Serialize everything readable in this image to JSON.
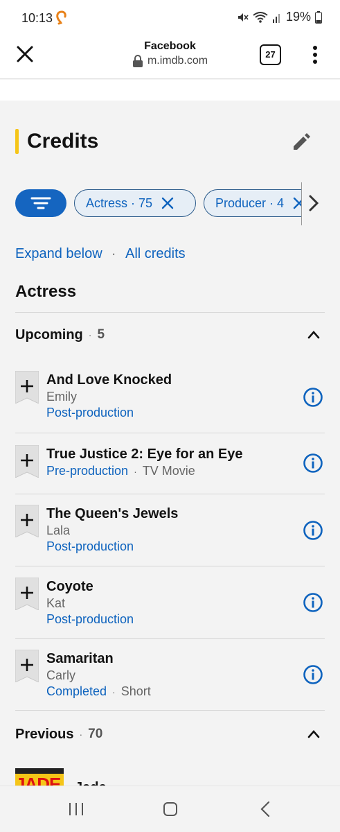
{
  "status_bar": {
    "time": "10:13",
    "battery": "19%",
    "icons": [
      "notification-icon",
      "mute-icon",
      "wifi-icon",
      "signal-icon",
      "battery-icon"
    ]
  },
  "browser": {
    "title": "Facebook",
    "url": "m.imdb.com",
    "tab_count": "27"
  },
  "page": {
    "heading": "Credits",
    "filters": {
      "chips": [
        {
          "label": "Actress · 75"
        },
        {
          "label": "Producer · 4"
        }
      ]
    },
    "links": {
      "expand": "Expand below",
      "separator": "·",
      "all": "All credits"
    },
    "section_title": "Actress",
    "upcoming": {
      "title": "Upcoming",
      "count": "5",
      "items": [
        {
          "title": "And Love Knocked",
          "role": "Emily",
          "status": "Post-production"
        },
        {
          "title": "True Justice 2: Eye for an Eye",
          "status": "Pre-production",
          "type": "TV Movie"
        },
        {
          "title": "The Queen's Jewels",
          "role": "Lala",
          "status": "Post-production"
        },
        {
          "title": "Coyote",
          "role": "Kat",
          "status": "Post-production"
        },
        {
          "title": "Samaritan",
          "role": "Carly",
          "status": "Completed",
          "type": "Short"
        }
      ]
    },
    "previous": {
      "title": "Previous",
      "count": "70",
      "peek_item_title": "Jade",
      "poster_text": "JADE"
    }
  },
  "colors": {
    "accent_yellow": "#f5c518",
    "link_blue": "#0e63be",
    "filter_blue": "#1565c0"
  }
}
